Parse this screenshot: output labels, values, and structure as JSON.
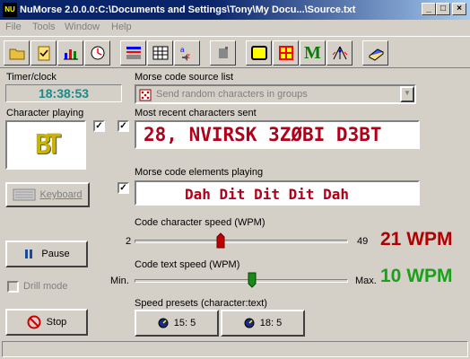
{
  "window": {
    "title": "NuMorse 2.0.0.0:C:\\Documents and Settings\\Tony\\My Docu...\\Source.txt",
    "app_icon_text": "NU"
  },
  "menu": [
    "File",
    "Tools",
    "Window",
    "Help"
  ],
  "toolbar": {
    "icons": [
      "open-folder-icon",
      "checklist-icon",
      "bar-chart-icon",
      "clock-icon",
      "keyboard-layout-icon",
      "grid-icon",
      "az-speaker-icon",
      "gray-block-icon",
      "yellow-square-icon",
      "red-cross-icon",
      "letter-m-icon",
      "antenna-icon",
      "book-icon"
    ],
    "m_label": "M"
  },
  "timer": {
    "label": "Timer/clock",
    "value": "18:38:53"
  },
  "source": {
    "label": "Morse code source list",
    "selected": "Send random characters in groups"
  },
  "char_playing": {
    "label": "Character playing",
    "value": "BT"
  },
  "recent": {
    "label": "Most recent characters sent",
    "text": "28, NVIRSK 3ZØBI D3BT"
  },
  "elements": {
    "label": "Morse code elements playing",
    "text": "Dah Dit Dit Dit Dah"
  },
  "keyboard_label": "Keyboard",
  "char_speed": {
    "label": "Code character speed (WPM)",
    "min": "2",
    "max": "49",
    "value": 21,
    "display": "21 WPM"
  },
  "text_speed": {
    "label": "Code text speed (WPM)",
    "min": "Min.",
    "max": "Max.",
    "fraction": 0.55,
    "display": "10 WPM"
  },
  "buttons": {
    "pause": "Pause",
    "stop": "Stop"
  },
  "drill_mode": "Drill mode",
  "presets": {
    "label": "Speed presets (character:text)",
    "items": [
      "15: 5",
      "18: 5"
    ]
  },
  "colors": {
    "title_bar": "#0a246a",
    "char_speed": "#b00000",
    "text_speed": "#1aa01a",
    "display_text": "#b0001a",
    "clock": "#1a8a8a",
    "letter_gold": "#c8b400"
  }
}
